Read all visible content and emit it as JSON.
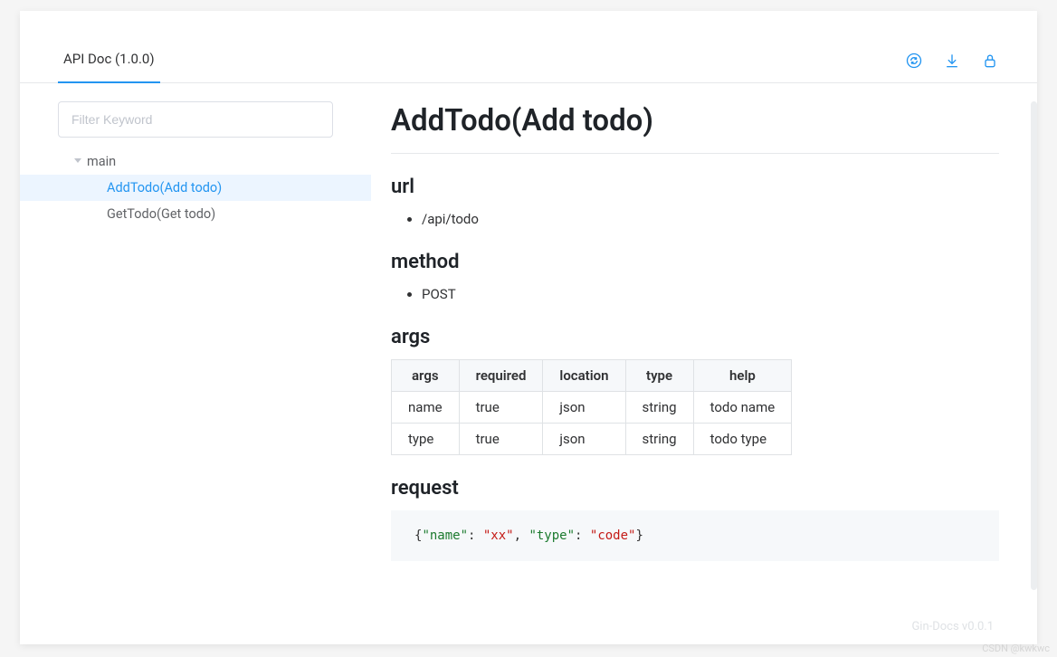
{
  "header": {
    "tab_label": "API Doc (1.0.0)"
  },
  "sidebar": {
    "filter_placeholder": "Filter Keyword",
    "group_label": "main",
    "items": [
      {
        "label": "AddTodo(Add todo)",
        "active": true
      },
      {
        "label": "GetTodo(Get todo)",
        "active": false
      }
    ]
  },
  "page": {
    "title": "AddTodo(Add todo)",
    "sections": {
      "url": {
        "heading": "url",
        "value": "/api/todo"
      },
      "method": {
        "heading": "method",
        "value": "POST"
      },
      "args": {
        "heading": "args",
        "columns": [
          "args",
          "required",
          "location",
          "type",
          "help"
        ],
        "rows": [
          {
            "args": "name",
            "required": "true",
            "location": "json",
            "type": "string",
            "help": "todo name"
          },
          {
            "args": "type",
            "required": "true",
            "location": "json",
            "type": "string",
            "help": "todo type"
          }
        ]
      },
      "request": {
        "heading": "request",
        "body_json": {
          "name": "xx",
          "type": "code"
        },
        "body_tokens": [
          {
            "t": "punct",
            "v": "{"
          },
          {
            "t": "key",
            "v": "\"name\""
          },
          {
            "t": "punct",
            "v": ": "
          },
          {
            "t": "str",
            "v": "\"xx\""
          },
          {
            "t": "punct",
            "v": ", "
          },
          {
            "t": "key",
            "v": "\"type\""
          },
          {
            "t": "punct",
            "v": ": "
          },
          {
            "t": "str",
            "v": "\"code\""
          },
          {
            "t": "punct",
            "v": "}"
          }
        ]
      }
    }
  },
  "footer": {
    "version_text": "Gin-Docs v0.0.1",
    "watermark": "CSDN @kwkwc"
  }
}
